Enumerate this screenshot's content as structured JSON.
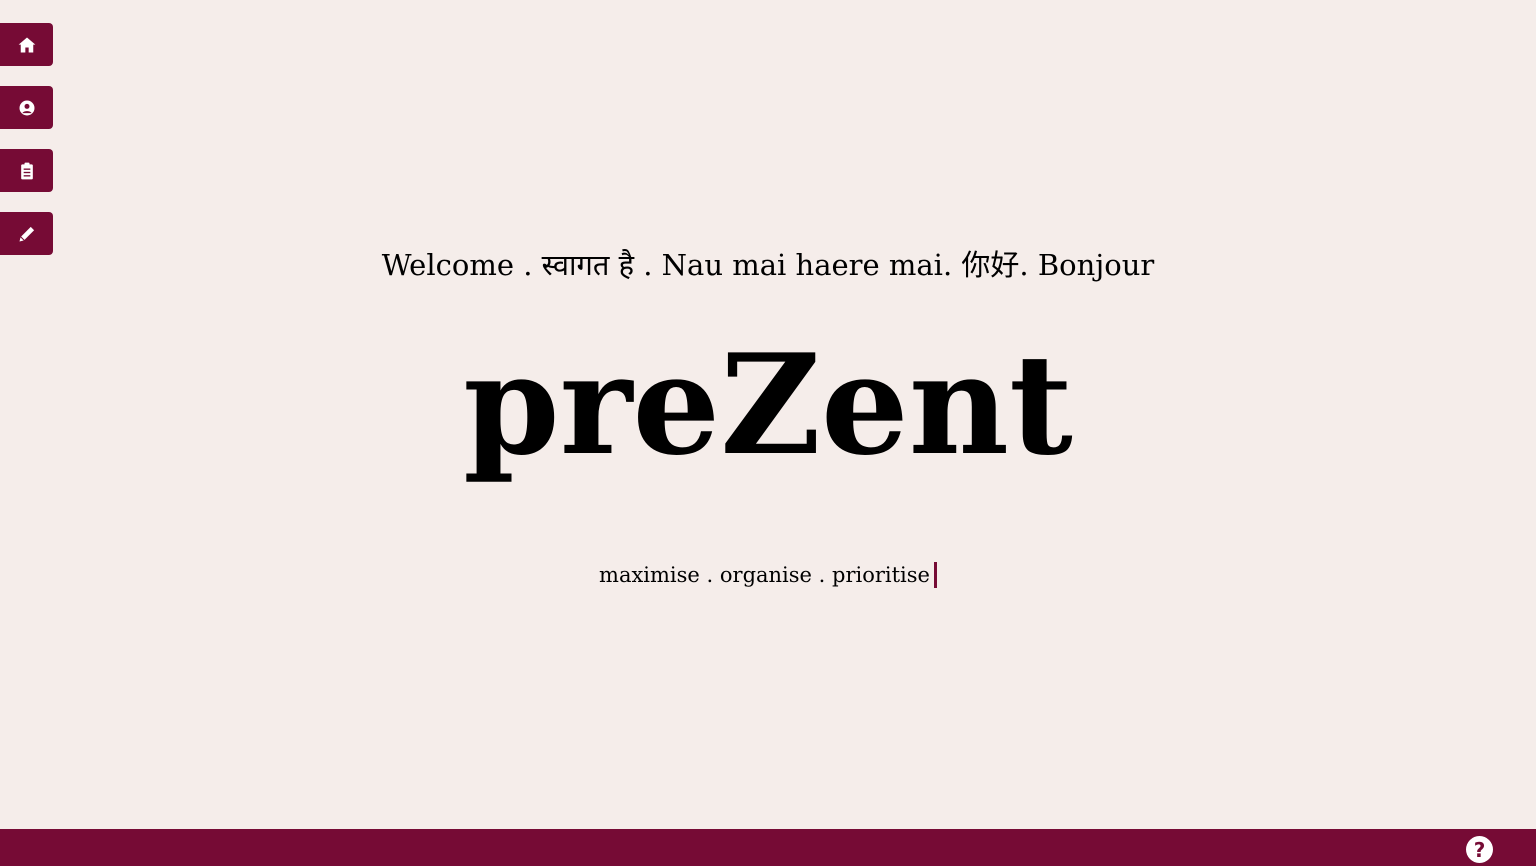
{
  "sidebar": {
    "items": [
      {
        "name": "home",
        "icon": "home-icon"
      },
      {
        "name": "profile",
        "icon": "user-circle-icon"
      },
      {
        "name": "tasks",
        "icon": "clipboard-icon"
      },
      {
        "name": "edit",
        "icon": "pencil-icon"
      }
    ]
  },
  "hero": {
    "welcome": "Welcome . स्वागत है . Nau mai haere mai. 你好. Bonjour",
    "brand": "preZent",
    "tagline": "maximise . organise . prioritise"
  },
  "footer": {
    "help_glyph": "?",
    "help_icon": "question-circle-icon"
  },
  "colors": {
    "accent": "#760b35",
    "background": "#f5edea",
    "text": "#000000"
  }
}
